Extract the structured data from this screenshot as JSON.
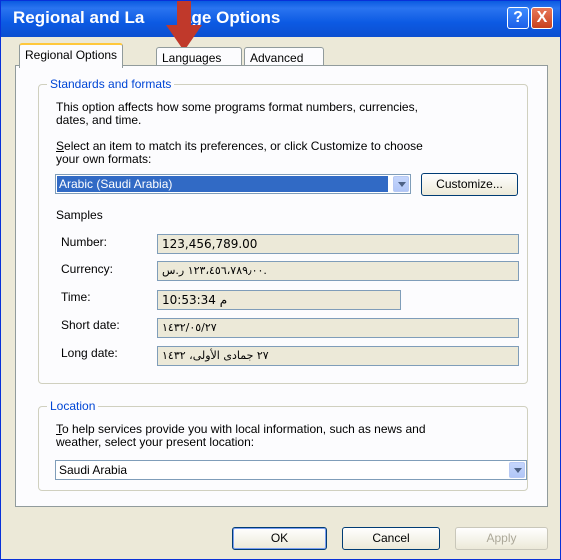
{
  "window": {
    "title": "Regional and Language Options",
    "title_left": "Regional and La",
    "title_right": "age Options",
    "help_glyph": "?",
    "close_glyph": "X"
  },
  "tabs": [
    {
      "label": "Regional Options",
      "active": true
    },
    {
      "label": "Languages",
      "active": false
    },
    {
      "label": "Advanced",
      "active": false
    }
  ],
  "standards": {
    "legend": "Standards and formats",
    "desc1": "This option affects how some programs format numbers, currencies,",
    "desc2": "dates, and time.",
    "select1": "elect an item to match its preferences, or click Customize to choose",
    "select_hot": "S",
    "select2": "your own formats:",
    "format_value": "Arabic (Saudi Arabia)",
    "customize_label": "Customize...",
    "samples_label": "Samples",
    "samples": [
      {
        "label": "Number:",
        "value": "123,456,789.00"
      },
      {
        "label": "Currency:",
        "value": "١٢٣،٤٥٦،٧٨٩٫٠٠ ر.س."
      },
      {
        "label": "Time:",
        "value": "10:53:34 م"
      },
      {
        "label": "Short date:",
        "value": "١٤٣٢/٠٥/٢٧"
      },
      {
        "label": "Long date:",
        "value": "٢٧ جمادى الأولى، ١٤٣٢"
      }
    ]
  },
  "location": {
    "legend": "Location",
    "hot": "T",
    "desc1": "o help services provide you with local information, such as news and",
    "desc2": "weather, select your present location:",
    "value": "Saudi Arabia"
  },
  "footer": {
    "ok": "OK",
    "cancel": "Cancel",
    "apply": "Apply"
  },
  "colors": {
    "title_bar": "#0a5be0",
    "legend": "#0046d5",
    "selection": "#316ac5",
    "arrow": "#c0392b"
  },
  "icons": {
    "annotation": "down-arrow-annotation-icon"
  }
}
